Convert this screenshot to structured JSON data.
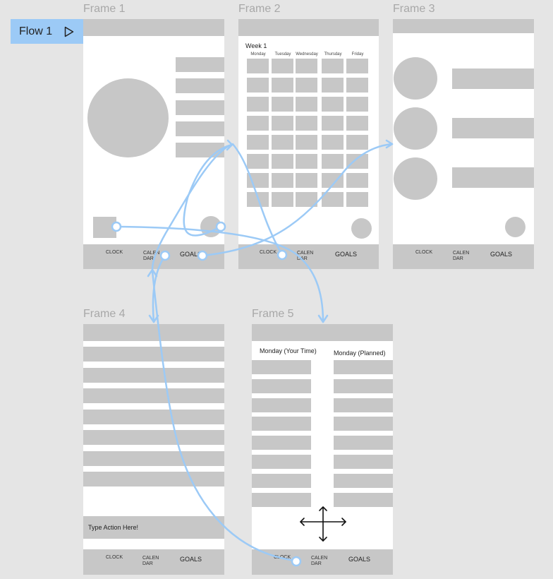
{
  "flow": {
    "label": "Flow 1"
  },
  "frames": {
    "frame1": {
      "title": "Frame 1",
      "nav": {
        "clock": "CLOCK",
        "calendar_1": "CALEN",
        "calendar_2": "DAR",
        "goals": "GOALS"
      }
    },
    "frame2": {
      "title": "Frame 2",
      "week": "Week 1",
      "days": [
        "Monday",
        "Tuesday",
        "Wednesday",
        "Thursday",
        "Friday"
      ],
      "nav": {
        "clock": "CLOCK",
        "calendar_1": "CALEN",
        "calendar_2": "DAR",
        "goals": "GOALS"
      }
    },
    "frame3": {
      "title": "Frame 3",
      "nav": {
        "clock": "CLOCK",
        "calendar_1": "CALEN",
        "calendar_2": "DAR",
        "goals": "GOALS"
      }
    },
    "frame4": {
      "title": "Frame 4",
      "input_text": "Type Action Here!",
      "nav": {
        "clock": "CLOCK",
        "calendar_1": "CALEN",
        "calendar_2": "DAR",
        "goals": "GOALS"
      }
    },
    "frame5": {
      "title": "Frame 5",
      "col_left": "Monday (Your Time)",
      "col_right": "Monday (Planned)",
      "nav": {
        "clock": "CLOCK",
        "calendar_1": "CALEN",
        "calendar_2": "DAR",
        "goals": "GOALS"
      }
    }
  },
  "colors": {
    "canvas": "#e5e5e5",
    "frame": "#ffffff",
    "placeholder": "#c7c7c7",
    "connector": "#9ccaf6"
  },
  "icons": {
    "play": "play-icon",
    "move": "move-arrows-icon"
  }
}
